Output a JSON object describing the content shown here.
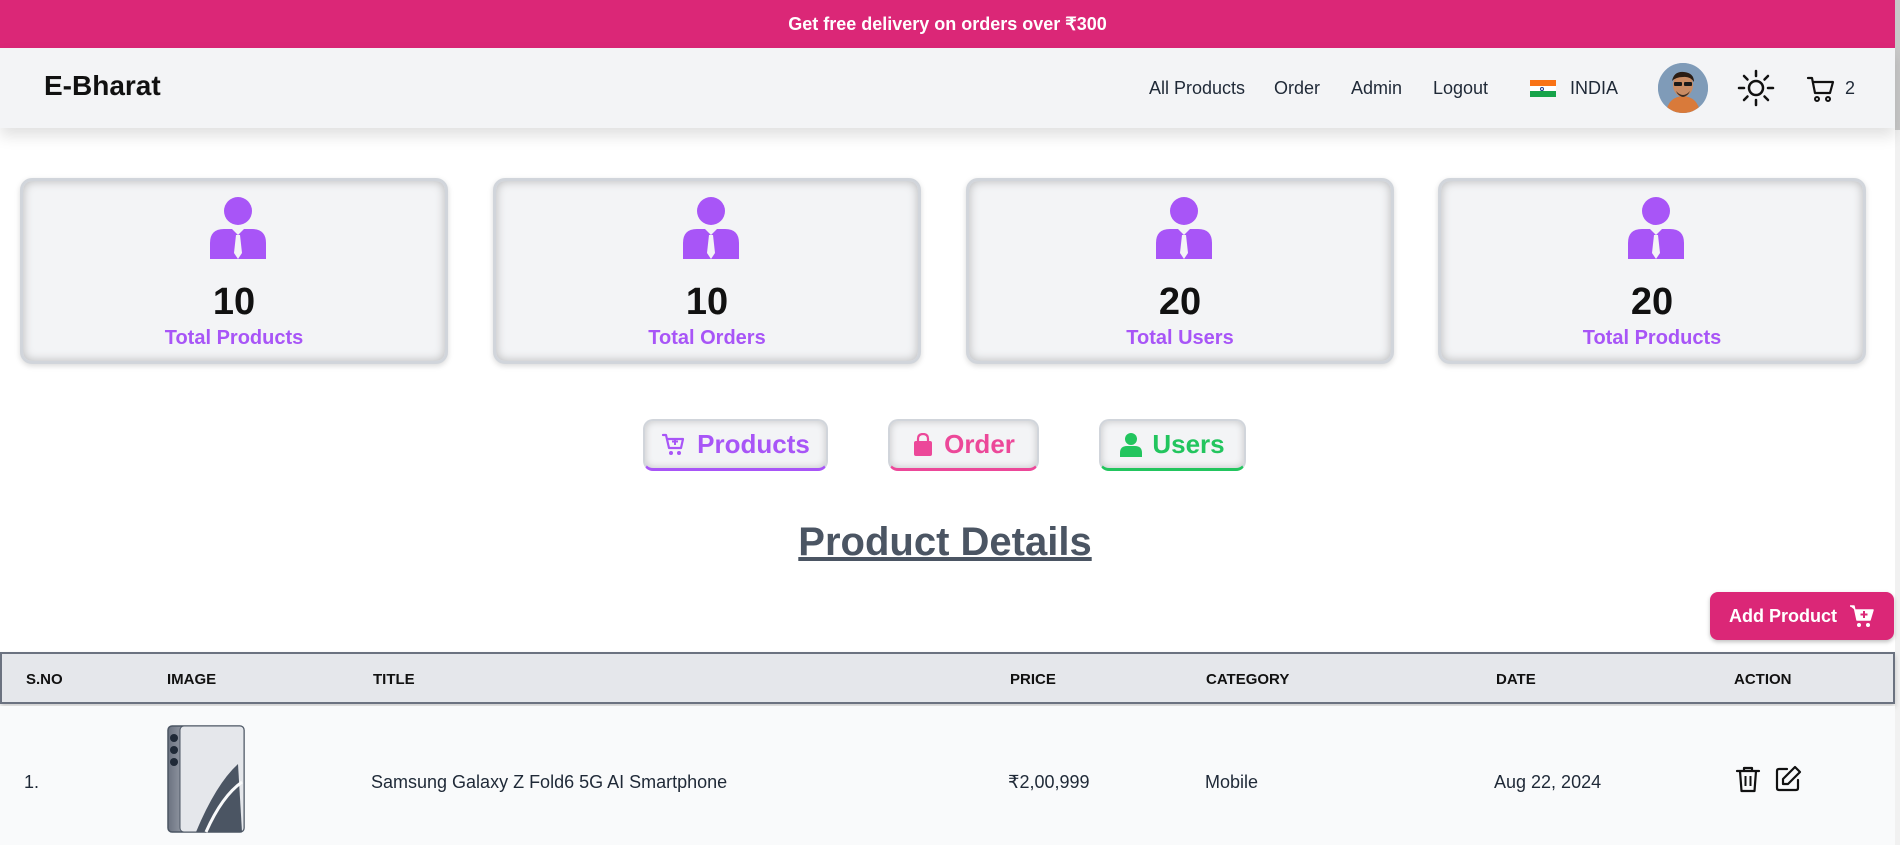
{
  "promo": {
    "text": "Get free delivery on orders over ₹300"
  },
  "navbar": {
    "logo": "E-Bharat",
    "links": [
      "All Products",
      "Order",
      "Admin",
      "Logout"
    ],
    "country": "INDIA",
    "cart_count": "2"
  },
  "stats": [
    {
      "value": "10",
      "label": "Total Products",
      "icon": "user-tie-icon"
    },
    {
      "value": "10",
      "label": "Total Orders",
      "icon": "user-tie-icon"
    },
    {
      "value": "20",
      "label": "Total Users",
      "icon": "user-tie-icon"
    },
    {
      "value": "20",
      "label": "Total Products",
      "icon": "user-tie-icon"
    }
  ],
  "tabs": [
    {
      "label": "Products",
      "icon": "cart-icon",
      "color": "#a855f7"
    },
    {
      "label": "Order",
      "icon": "shopping-bag-icon",
      "color": "#ec4899"
    },
    {
      "label": "Users",
      "icon": "user-icon",
      "color": "#22c55e"
    }
  ],
  "section_title": "Product Details",
  "add_product_label": "Add Product",
  "table": {
    "columns": [
      "S.NO",
      "IMAGE",
      "TITLE",
      "PRICE",
      "CATEGORY",
      "DATE",
      "ACTION"
    ],
    "rows": [
      {
        "sno": "1.",
        "title": "Samsung Galaxy Z Fold6 5G AI Smartphone",
        "price": "₹2,00,999",
        "category": "Mobile",
        "date": "Aug 22, 2024"
      }
    ]
  },
  "colors": {
    "brand": "#db2777",
    "stat_accent": "#a855f7",
    "tab_products": "#a855f7",
    "tab_order": "#ec4899",
    "tab_users": "#22c55e"
  }
}
